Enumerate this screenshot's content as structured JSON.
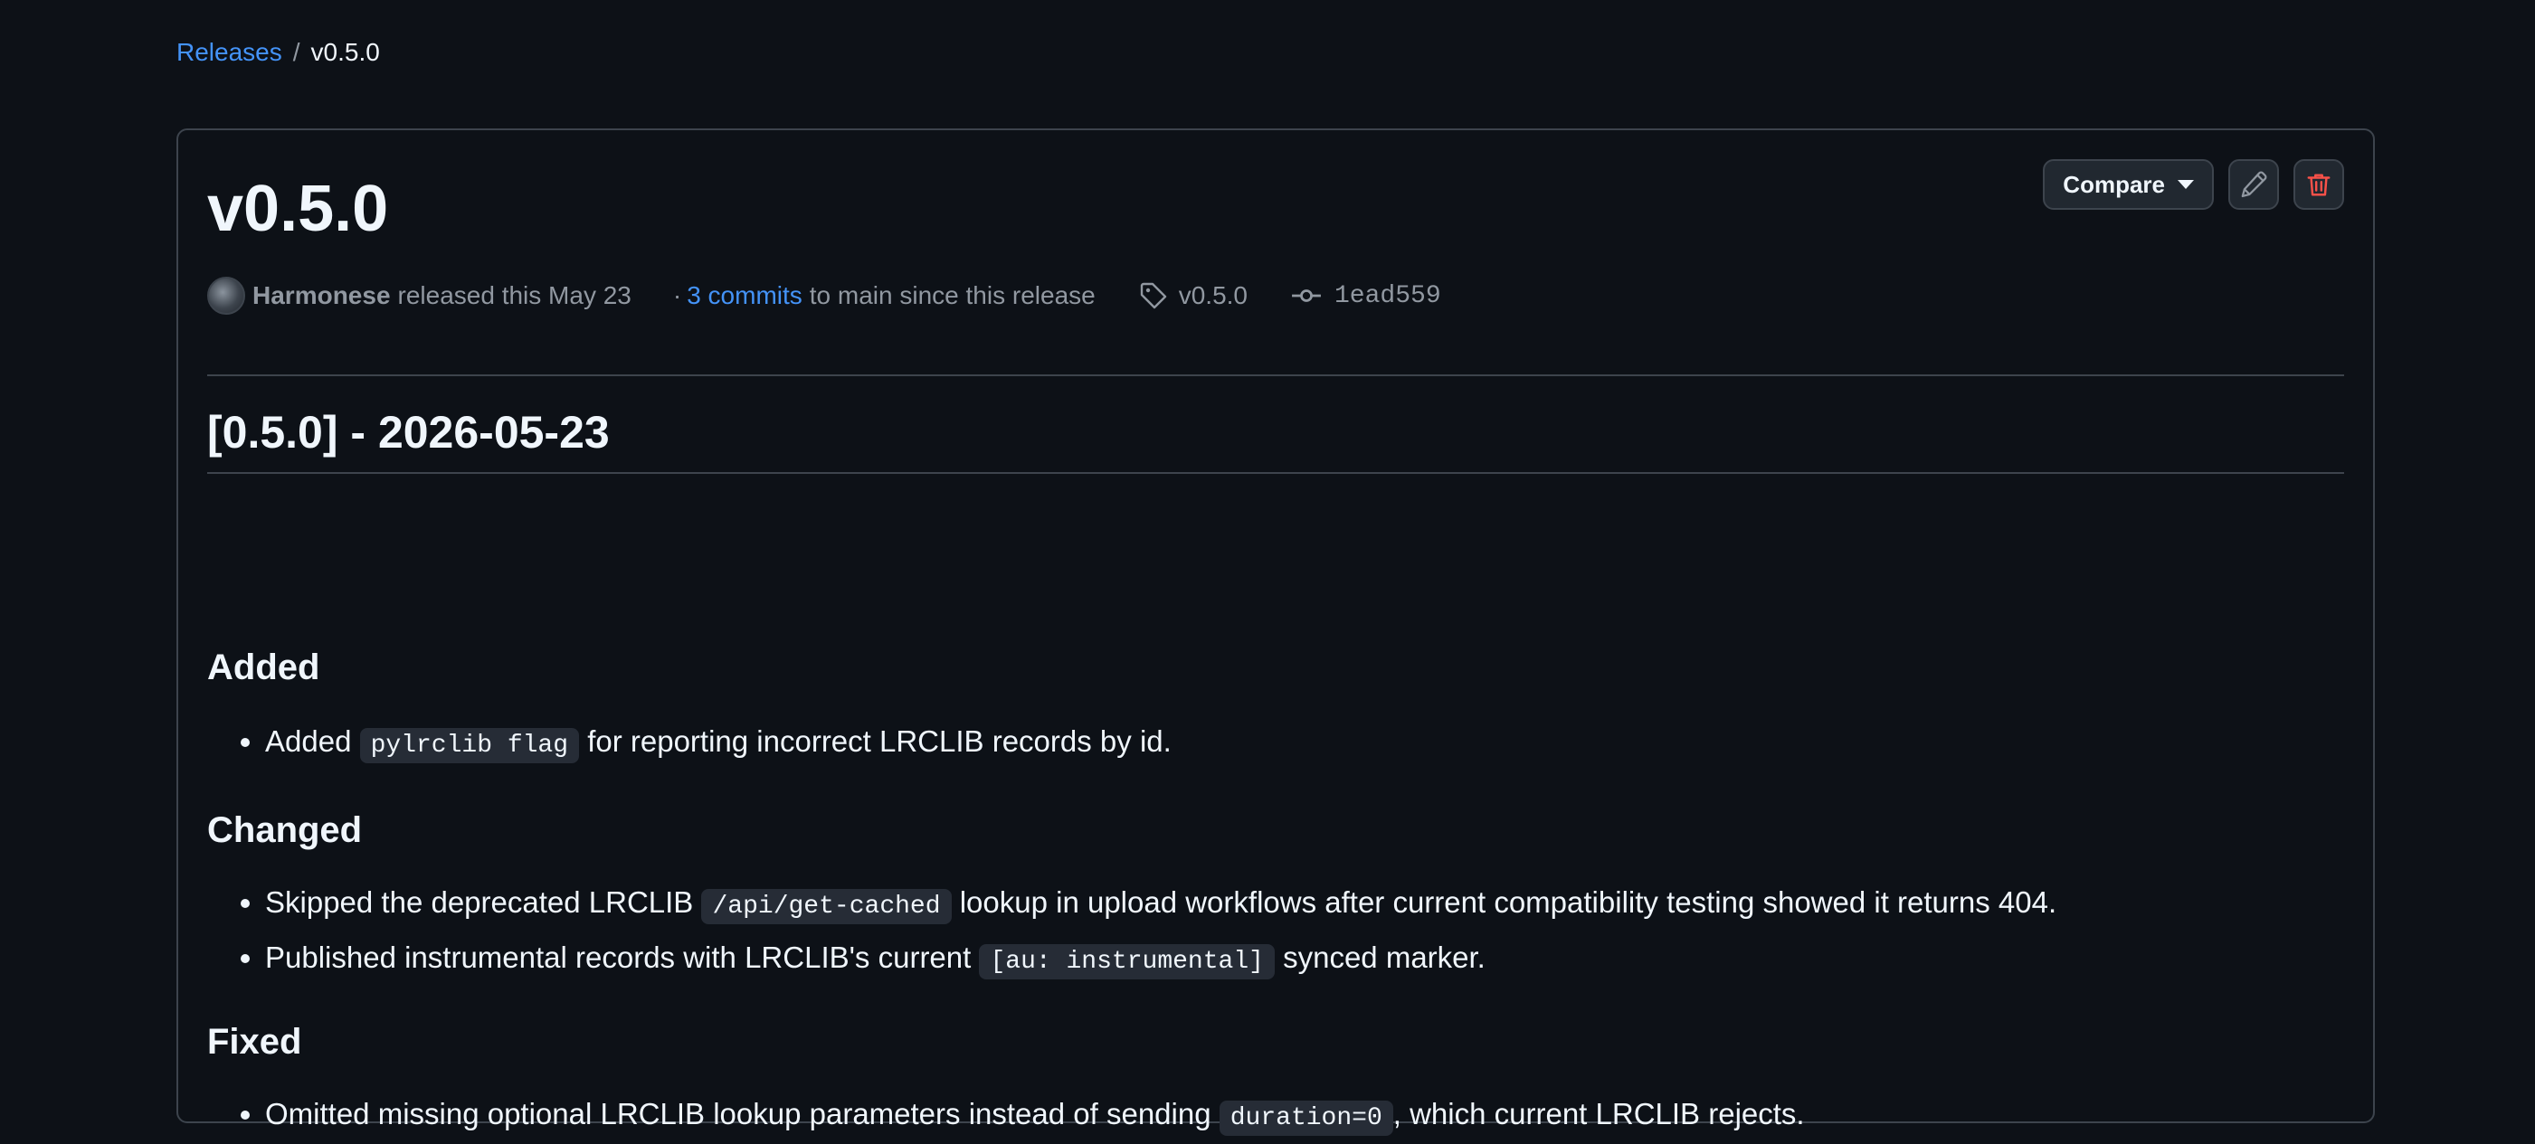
{
  "breadcrumb": {
    "releases_label": "Releases",
    "separator": "/",
    "current": "v0.5.0"
  },
  "release": {
    "title": "v0.5.0",
    "actions": {
      "compare_label": "Compare",
      "edit_icon": "pencil-icon",
      "delete_icon": "trash-icon"
    },
    "meta": {
      "author": "Harmonese",
      "released_text": "released this May 23",
      "dot": "·",
      "commits_link": "3 commits",
      "commits_suffix": "to main since this release",
      "tag_icon": "tag-icon",
      "tag": "v0.5.0",
      "commit_icon": "git-commit-icon",
      "commit_hash": "1ead559"
    },
    "body": {
      "heading": "[0.5.0] - 2026-05-23",
      "sections": {
        "added": {
          "title": "Added",
          "item1": {
            "before": "Added ",
            "code": "pylrclib flag",
            "after": " for reporting incorrect LRCLIB records by id."
          }
        },
        "changed": {
          "title": "Changed",
          "item1": {
            "before": "Skipped the deprecated LRCLIB ",
            "code": "/api/get-cached",
            "after": " lookup in upload workflows after current compatibility testing showed it returns 404."
          },
          "item2": {
            "before": "Published instrumental records with LRCLIB's current ",
            "code": "[au: instrumental]",
            "after": " synced marker."
          }
        },
        "fixed": {
          "title": "Fixed",
          "item1": {
            "before": "Omitted missing optional LRCLIB lookup parameters instead of sending ",
            "code": "duration=0",
            "after": ", which current LRCLIB rejects."
          }
        }
      }
    }
  },
  "colors": {
    "background": "#0d1117",
    "link": "#4493f8",
    "border": "#3d444d",
    "danger": "#f85149",
    "muted": "#9198a1"
  }
}
